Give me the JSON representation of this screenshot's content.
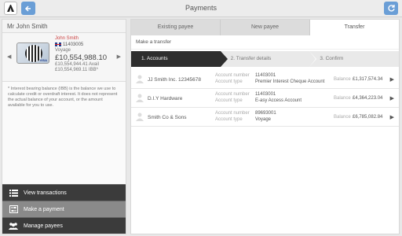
{
  "header": {
    "title": "Payments"
  },
  "account": {
    "name": "Mr John Smith",
    "holder": "John Smith",
    "sort_code": "11403005",
    "type": "Voyage",
    "balance": "£10,554,988.10",
    "available": "£10,554,944.41 Avail",
    "ibb": "£10,554,969.11 IBB*",
    "note": "* Interest bearing balance (IBB) is the balance we use to calculate credit or overdraft interest. It does not represent the actual balance of your account, or the amount available for you to use."
  },
  "menu": [
    {
      "label": "View transactions",
      "icon": "list-icon"
    },
    {
      "label": "Make a payment",
      "icon": "sliders-icon"
    },
    {
      "label": "Manage payees",
      "icon": "people-icon"
    }
  ],
  "tabs": [
    "Existing payee",
    "New payee",
    "Transfer"
  ],
  "subhead": "Make a transfer",
  "steps": [
    "1. Accounts",
    "2. Transfer details",
    "3. Confirm"
  ],
  "labels": {
    "account_number": "Account number",
    "account_type": "Account type",
    "balance": "Balance"
  },
  "payees": [
    {
      "name": "JJ Smith Inc. 12345678",
      "number": "11403001",
      "type": "Premier Interest Cheque Account",
      "balance": "£1,317,574.34"
    },
    {
      "name": "D.I.Y Hardware",
      "number": "11403001",
      "type": "E-asy Access Account",
      "balance": "£4,364,223.04"
    },
    {
      "name": "Smith Co & Sons",
      "number": "89693001",
      "type": "Voyage",
      "balance": "£6,785,082.84"
    }
  ]
}
